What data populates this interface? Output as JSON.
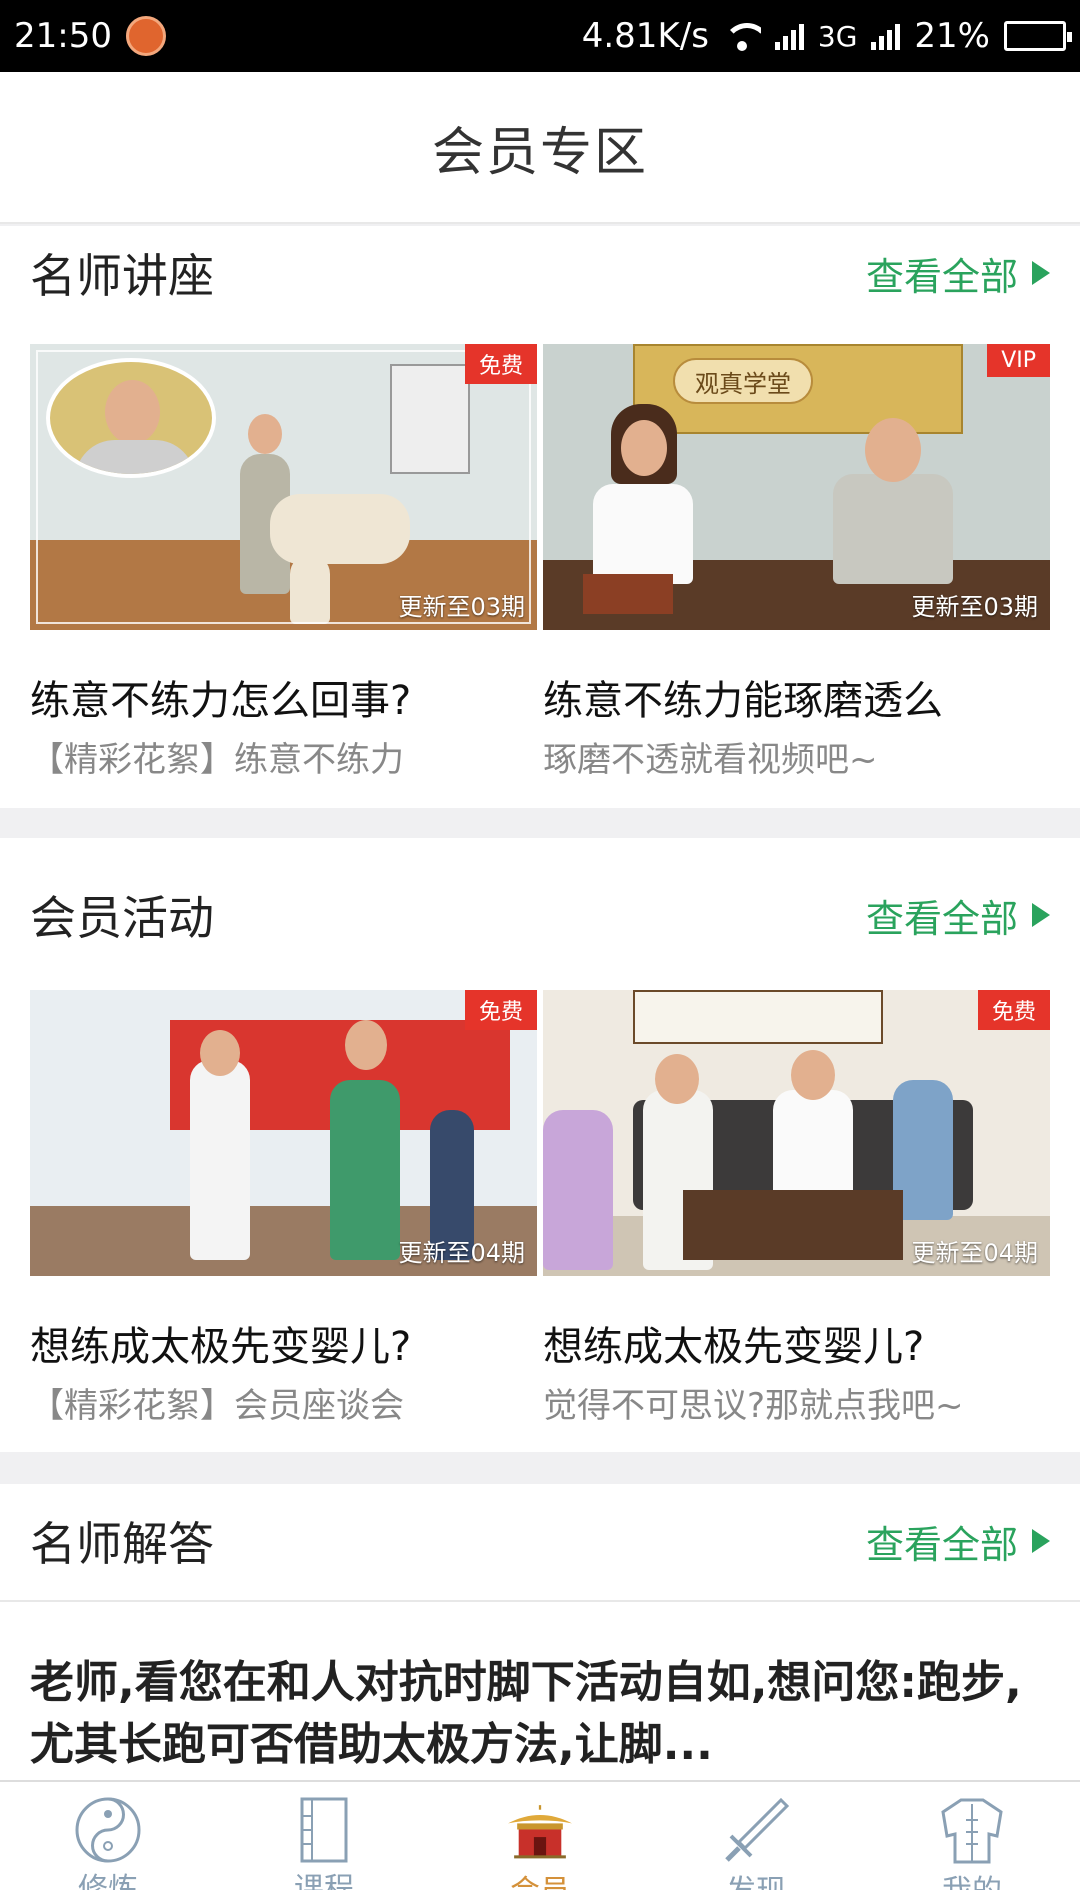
{
  "status_bar": {
    "time": "21:50",
    "network_speed": "4.81K/s",
    "network_type": "3G",
    "battery": "21%",
    "battery_level": 0.21
  },
  "header": {
    "title": "会员专区"
  },
  "sections": {
    "lectures": {
      "title": "名师讲座",
      "more_label": "查看全部",
      "cards": [
        {
          "badge": "免费",
          "update": "更新至03期",
          "title": "练意不练力怎么回事?",
          "subtitle": "【精彩花絮】练意不练力"
        },
        {
          "badge": "VIP",
          "update": "更新至03期",
          "title": "练意不练力能琢磨透么",
          "subtitle": "琢磨不透就看视频吧~",
          "thumb_caption": "观真学堂"
        }
      ]
    },
    "activities": {
      "title": "会员活动",
      "more_label": "查看全部",
      "cards": [
        {
          "badge": "免费",
          "update": "更新至04期",
          "title": "想练成太极先变婴儿?",
          "subtitle": "【精彩花絮】会员座谈会"
        },
        {
          "badge": "免费",
          "update": "更新至04期",
          "title": "想练成太极先变婴儿?",
          "subtitle": "觉得不可思议?那就点我吧~"
        }
      ]
    },
    "answers": {
      "title": "名师解答",
      "more_label": "查看全部",
      "question": "老师,看您在和人对抗时脚下活动自如,想问您:跑步,尤其长跑可否借助太极方法,让脚..."
    }
  },
  "tabbar": {
    "items": [
      {
        "label": "修炼",
        "icon": "taiji-icon"
      },
      {
        "label": "课程",
        "icon": "book-icon"
      },
      {
        "label": "会员",
        "icon": "pavilion-icon",
        "active": true
      },
      {
        "label": "发现",
        "icon": "sword-icon"
      },
      {
        "label": "我的",
        "icon": "robe-icon"
      }
    ]
  },
  "colors": {
    "accent_green": "#2aa35d",
    "badge_red": "#e5342a",
    "active_tab": "#d4913a",
    "inactive_tab": "#8aa0b4"
  }
}
